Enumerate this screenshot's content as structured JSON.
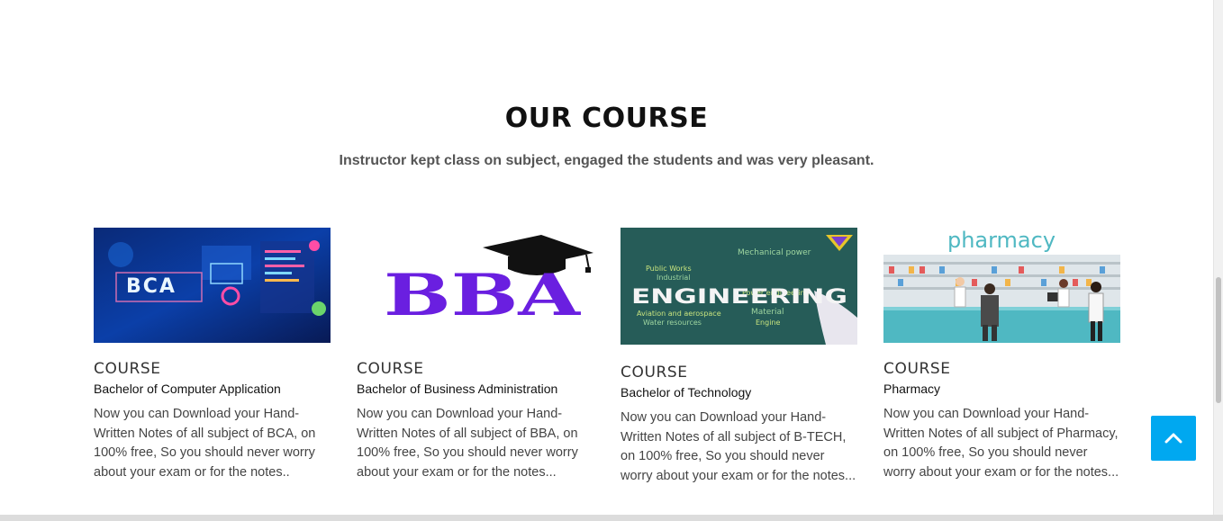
{
  "section": {
    "title": "OUR COURSE",
    "subtitle": "Instructor kept class on subject, engaged the students and was very pleasant."
  },
  "courses": [
    {
      "tag": "COURSE",
      "name": "Bachelor of Computer Application",
      "description": "Now you can Download your Hand-Written Notes of all subject of BCA, on 100% free, So you should never worry about your exam or for the notes..",
      "image_text": "BCA"
    },
    {
      "tag": "COURSE",
      "name": "Bachelor of Business Administration",
      "description": "Now you can Download your Hand-Written Notes of all subject of BBA, on 100% free, So you should never worry about your exam or for the notes...",
      "image_text": "BBA"
    },
    {
      "tag": "COURSE",
      "name": "Bachelor of Technology",
      "description": "Now you can Download your Hand-Written Notes of all subject of B-TECH, on 100% free, So you should never worry about your exam or for the notes...",
      "image_text": "ENGINEERING"
    },
    {
      "tag": "COURSE",
      "name": "Pharmacy",
      "description": "Now you can Download your Hand-Written Notes of all subject of Pharmacy, on 100% free, So you should never worry about your exam or for the notes...",
      "image_text": "pharmacy"
    }
  ],
  "colors": {
    "accent": "#00a8f0",
    "bba_purple": "#6a1fe0",
    "pharmacy_teal": "#4fb8c2"
  },
  "icons": {
    "back_to_top": "chevron-up-icon"
  }
}
